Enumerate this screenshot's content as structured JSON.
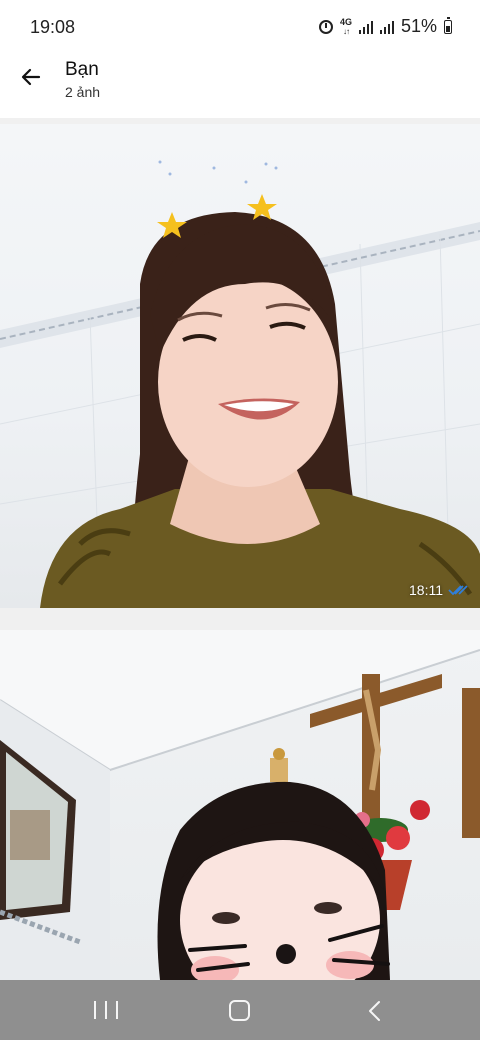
{
  "status_bar": {
    "time": "19:08",
    "network_type": "4G",
    "battery_percent": "51%",
    "icons": [
      "alarm-icon",
      "signal-icon",
      "signal-icon",
      "battery-icon"
    ]
  },
  "header": {
    "title": "Bạn",
    "subtitle": "2 ảnh",
    "back_icon": "arrow-left-icon"
  },
  "photos": [
    {
      "timestamp": "18:11",
      "status_icon": "double-check-icon",
      "status_color": "#2f7fdc"
    },
    {
      "timestamp": "",
      "status_icon": ""
    }
  ],
  "nav_bar": {
    "buttons": [
      "recents-icon",
      "home-icon",
      "back-icon"
    ],
    "background": "#8f8f8f"
  }
}
